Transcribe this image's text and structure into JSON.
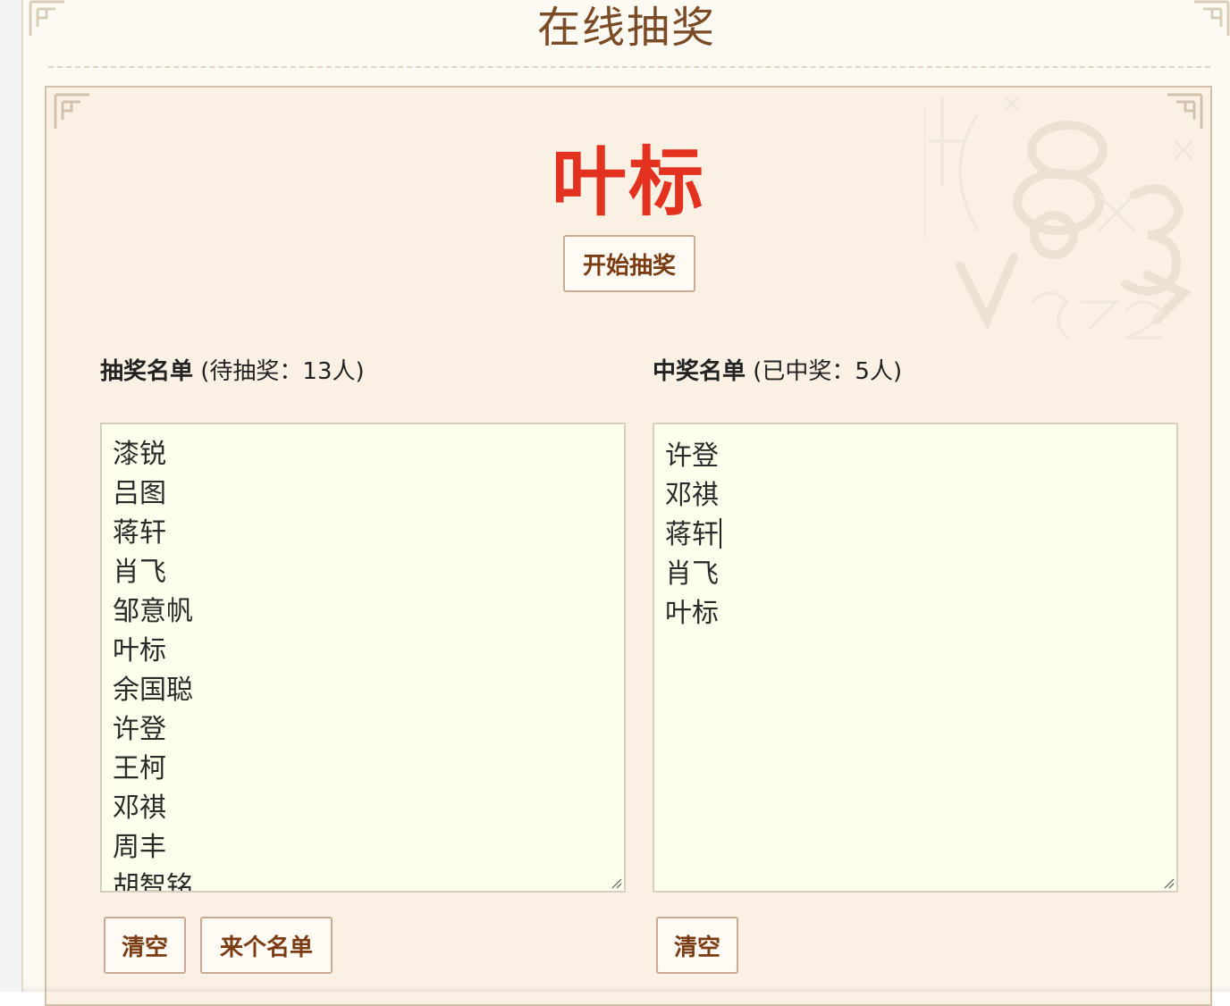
{
  "header": {
    "title": "在线抽奖"
  },
  "draw": {
    "current_winner": "叶标",
    "start_button_label": "开始抽奖"
  },
  "pool": {
    "heading_bold": "抽奖名单",
    "heading_meta": " (待抽奖：13人)",
    "names": [
      "漆锐",
      "吕图",
      "蒋轩",
      "肖飞",
      "邹意帆",
      "叶标",
      "余国聪",
      "许登",
      "王柯",
      "邓祺",
      "周丰",
      "胡智铭"
    ],
    "clear_button_label": "清空",
    "demo_list_button_label": "来个名单"
  },
  "winners": {
    "heading_bold": "中奖名单",
    "heading_meta": " (已中奖：5人)",
    "names": [
      "许登",
      "邓祺",
      "蒋轩",
      "肖飞",
      "叶标"
    ],
    "clear_button_label": "清空"
  },
  "colors": {
    "winner_red": "#e3321f",
    "title_brown": "#7b4a26",
    "button_text": "#7b3c14",
    "panel_bg": "#faf1e4",
    "textarea_bg": "#fefeec"
  },
  "icons": [
    "corner-ornament-icon",
    "resize-grip-icon",
    "numbers-decoration"
  ]
}
